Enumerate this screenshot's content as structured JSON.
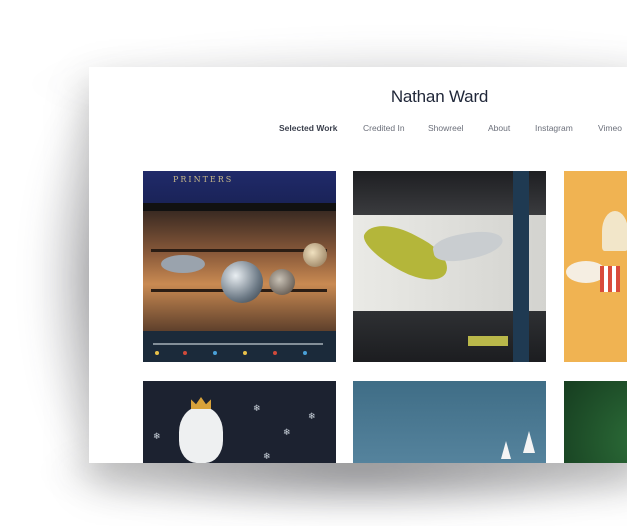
{
  "site": {
    "title": "Nathan Ward"
  },
  "nav": {
    "items": [
      {
        "label": "Selected Work",
        "active": true
      },
      {
        "label": "Credited In",
        "active": false
      },
      {
        "label": "Showreel",
        "active": false
      },
      {
        "label": "About",
        "active": false
      },
      {
        "label": "Instagram",
        "active": false
      },
      {
        "label": "Vimeo",
        "active": false
      }
    ]
  },
  "gallery": {
    "tiles": [
      {
        "name": "shop-window-tile",
        "sign_text": "PRINTERS"
      },
      {
        "name": "gallery-installation-tile"
      },
      {
        "name": "ice-cream-tile"
      },
      {
        "name": "polar-bear-window-tile"
      },
      {
        "name": "blue-sea-boats-tile"
      },
      {
        "name": "green-foliage-tile"
      }
    ]
  },
  "colors": {
    "title": "#1f2638",
    "nav_active": "#3a3f4c",
    "nav": "#6b6f7a",
    "background": "#ffffff"
  }
}
